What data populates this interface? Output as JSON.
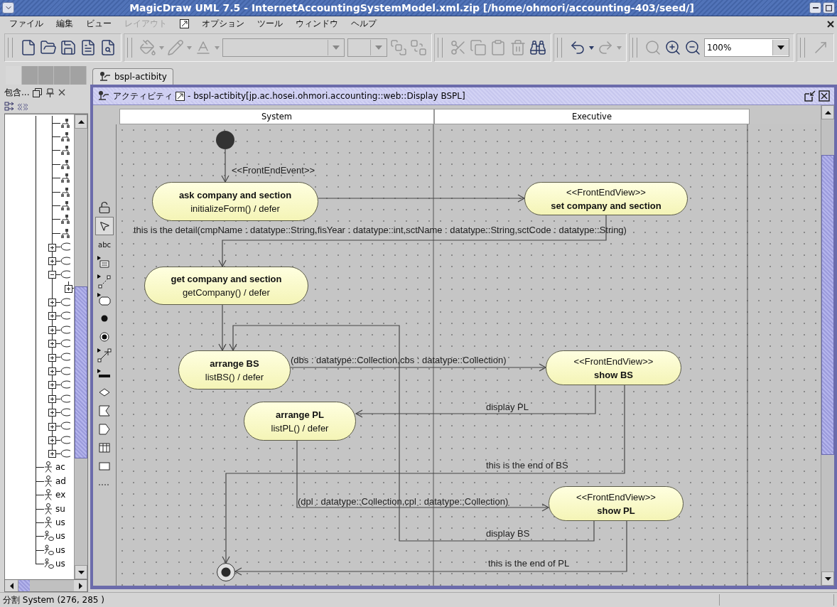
{
  "window": {
    "title": "MagicDraw UML 7.5 - InternetAccountingSystemModel.xml.zip [/home/ohmori/accounting-403/seed/]"
  },
  "menu": [
    {
      "kind": "text",
      "label": "ファイル",
      "disabled": false
    },
    {
      "kind": "text",
      "label": "編集",
      "disabled": false
    },
    {
      "kind": "text",
      "label": "ビュー",
      "disabled": false
    },
    {
      "kind": "text",
      "label": "レイアウト",
      "disabled": true
    },
    {
      "kind": "icon",
      "disabled": false
    },
    {
      "kind": "text",
      "label": "オプション",
      "disabled": false
    },
    {
      "kind": "text",
      "label": "ツール",
      "disabled": false
    },
    {
      "kind": "text",
      "label": "ウィンドウ",
      "disabled": false
    },
    {
      "kind": "text",
      "label": "ヘルプ",
      "disabled": false
    }
  ],
  "toolbar": [
    {
      "tools": [
        {
          "kind": "new",
          "disabled": false
        },
        {
          "kind": "open",
          "disabled": false
        },
        {
          "kind": "save",
          "disabled": false
        },
        {
          "kind": "page",
          "disabled": false
        },
        {
          "kind": "preview",
          "disabled": false
        }
      ]
    },
    {
      "tools": [
        {
          "kind": "fill-color",
          "disabled": true
        },
        {
          "kind": "line-color",
          "disabled": true
        },
        {
          "kind": "text-color",
          "disabled": true
        },
        {
          "kind": "font-combo",
          "disabled": true
        },
        {
          "kind": "size-combo",
          "disabled": true
        },
        {
          "kind": "bring-front",
          "disabled": true
        },
        {
          "kind": "send-back",
          "disabled": true
        }
      ]
    },
    {
      "tools": [
        {
          "kind": "cut",
          "disabled": true
        },
        {
          "kind": "copy",
          "disabled": true
        },
        {
          "kind": "paste",
          "disabled": true
        },
        {
          "kind": "delete",
          "disabled": true
        },
        {
          "kind": "find",
          "disabled": false
        }
      ]
    },
    {
      "tools": [
        {
          "kind": "undo",
          "disabled": false
        },
        {
          "kind": "redo",
          "disabled": true
        }
      ]
    },
    {
      "tools": [
        {
          "kind": "zoom",
          "disabled": true
        },
        {
          "kind": "zoom-in",
          "disabled": false
        },
        {
          "kind": "zoom-out",
          "disabled": false
        },
        {
          "kind": "zoom-combo",
          "value": "100%",
          "disabled": false
        }
      ]
    },
    {
      "tools": [
        {
          "kind": "path",
          "disabled": true
        }
      ]
    }
  ],
  "browser_tabs": [
    {
      "selected": true
    },
    {
      "selected": false
    },
    {
      "selected": false
    },
    {
      "selected": false
    },
    {
      "selected": false
    }
  ],
  "document_tabs": [
    {
      "label": "bspl-actibity",
      "selected": true
    }
  ],
  "browser": {
    "title": "包含...",
    "tree": [
      {
        "kind": "continued",
        "children": [
          {
            "kind": "action"
          },
          {
            "kind": "action"
          },
          {
            "kind": "action"
          },
          {
            "kind": "action"
          },
          {
            "kind": "action"
          },
          {
            "kind": "action"
          },
          {
            "kind": "action"
          },
          {
            "kind": "action"
          },
          {
            "kind": "action"
          },
          {
            "kind": "usecase",
            "expanded": false
          },
          {
            "kind": "usecase",
            "expanded": false
          },
          {
            "kind": "usecase",
            "expanded": true,
            "children": [
              {
                "expanded": false
              }
            ]
          },
          {
            "kind": "usecase",
            "expanded": false
          },
          {
            "kind": "usecase",
            "expanded": false
          },
          {
            "kind": "usecase",
            "expanded": false
          },
          {
            "kind": "usecase",
            "expanded": false
          },
          {
            "kind": "usecase",
            "expanded": false
          },
          {
            "kind": "usecase",
            "expanded": false
          },
          {
            "kind": "usecase",
            "expanded": false
          },
          {
            "kind": "usecase",
            "expanded": false
          },
          {
            "kind": "usecase",
            "expanded": false
          },
          {
            "kind": "usecase",
            "expanded": false
          },
          {
            "kind": "usecase",
            "expanded": false
          },
          {
            "kind": "usecase",
            "expanded": false
          }
        ]
      },
      {
        "kind": "actor",
        "label": "ac"
      },
      {
        "kind": "actor",
        "label": "ad"
      },
      {
        "kind": "actor",
        "label": "ex"
      },
      {
        "kind": "actor",
        "label": "su"
      },
      {
        "kind": "actor",
        "label": "us"
      },
      {
        "kind": "collaboration",
        "label": "us"
      },
      {
        "kind": "collaboration",
        "label": "us"
      },
      {
        "kind": "collaboration",
        "label": "us"
      }
    ]
  },
  "diagram": {
    "title": "アクティビティ",
    "subtitle": "- bspl-actibity[jp.ac.hosei.ohmori.accounting::web::Display BSPL]",
    "partitions": [
      {
        "name": "System"
      },
      {
        "name": "Executive"
      }
    ],
    "nodes": [
      {
        "kind": "initial"
      },
      {
        "kind": "action",
        "name": "ask company and section",
        "behavior": "initializeForm() / defer"
      },
      {
        "kind": "action",
        "stereotype": "<<FrontEndView>>",
        "name": "set company and section"
      },
      {
        "kind": "action",
        "name": "get company and section",
        "behavior": "getCompany() / defer"
      },
      {
        "kind": "action",
        "name": "arrange BS",
        "behavior": "listBS() / defer"
      },
      {
        "kind": "action",
        "stereotype": "<<FrontEndView>>",
        "name": "show BS"
      },
      {
        "kind": "action",
        "name": "arrange PL",
        "behavior": "listPL() / defer"
      },
      {
        "kind": "action",
        "stereotype": "<<FrontEndView>>",
        "name": "show PL"
      },
      {
        "kind": "final"
      }
    ],
    "edges": [
      {
        "kind": "flow",
        "label": "<<FrontEndEvent>>"
      },
      {
        "kind": "flow"
      },
      {
        "kind": "flow",
        "label": "this is the detail(cmpName : datatype::String,fisYear : datatype::int,sctName : datatype::String,sctCode : datatype::String)"
      },
      {
        "kind": "flow"
      },
      {
        "kind": "flow",
        "label": "(dbs : datatype::Collection,cbs : datatype::Collection)"
      },
      {
        "kind": "flow",
        "label": "display PL"
      },
      {
        "kind": "flow",
        "label": "this is the end of BS"
      },
      {
        "kind": "flow",
        "label": "(dpl : datatype::Collection,cpl : datatype::Collection)"
      },
      {
        "kind": "flow",
        "label": "display BS"
      },
      {
        "kind": "flow",
        "label": "this is the end of PL"
      }
    ]
  },
  "palette": [
    {
      "kind": "lock",
      "selected": false
    },
    {
      "kind": "pointer",
      "selected": true
    },
    {
      "kind": "text",
      "label": "abc",
      "selected": false
    },
    {
      "kind": "note",
      "selected": false
    },
    {
      "kind": "anchor",
      "selected": false
    },
    {
      "kind": "action",
      "selected": false
    },
    {
      "kind": "initial",
      "selected": false
    },
    {
      "kind": "final",
      "selected": false
    },
    {
      "kind": "transition",
      "selected": false
    },
    {
      "kind": "fork",
      "selected": false
    },
    {
      "kind": "decision",
      "selected": false
    },
    {
      "kind": "receive",
      "selected": false
    },
    {
      "kind": "send",
      "selected": false
    },
    {
      "kind": "swimlane",
      "selected": false
    },
    {
      "kind": "object",
      "selected": false
    },
    {
      "kind": "separator",
      "selected": false
    }
  ],
  "status_bar": {
    "text": "分割 System (276, 285 )"
  }
}
